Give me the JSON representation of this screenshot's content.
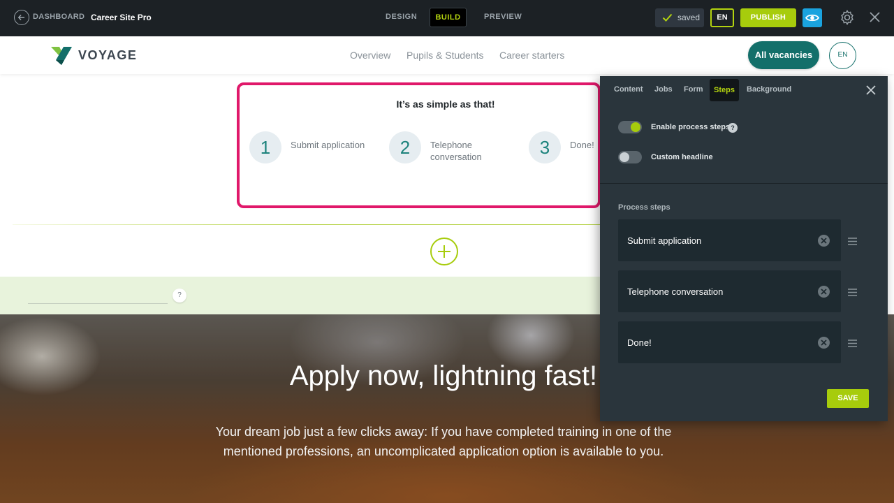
{
  "topbar": {
    "dashboard_label": "DASHBOARD",
    "site_name": "Career Site Pro",
    "modes": [
      {
        "label": "DESIGN",
        "active": false
      },
      {
        "label": "BUILD",
        "active": true
      },
      {
        "label": "PREVIEW",
        "active": false
      }
    ],
    "saved_label": "saved",
    "language": "EN",
    "publish_label": "PUBLISH"
  },
  "site": {
    "brand": "VOYAGE",
    "nav": [
      "Overview",
      "Pupils & Students",
      "Career starters"
    ],
    "cta_label": "All vacancies",
    "language": "EN"
  },
  "steps_section": {
    "title": "It’s as simple as that!",
    "steps": [
      {
        "number": "1",
        "label": "Submit application"
      },
      {
        "number": "2",
        "label": "Telephone conversation"
      },
      {
        "number": "3",
        "label": "Done!"
      }
    ]
  },
  "band": {
    "help": "?"
  },
  "hero": {
    "title": "Apply now, lightning fast!",
    "text": "Your dream job just a few clicks away: If you have completed training in one of the mentioned professions, an uncomplicated application option is available to you."
  },
  "panel": {
    "tabs": [
      "Content",
      "Jobs",
      "Form",
      "Steps",
      "Background"
    ],
    "active_tab": "Steps",
    "toggles": [
      {
        "label": "Enable process steps",
        "on": true
      },
      {
        "label": "Custom headline",
        "on": false
      }
    ],
    "help": "?",
    "section_label": "Process steps",
    "steps": [
      "Submit application",
      "Telephone conversation",
      "Done!"
    ],
    "save_label": "SAVE"
  },
  "colors": {
    "accent_green": "#a7cc0c",
    "teal": "#136f6a",
    "highlight": "#e0186a",
    "panel_bg": "#2a353c",
    "preview_blue": "#1aa3df"
  }
}
